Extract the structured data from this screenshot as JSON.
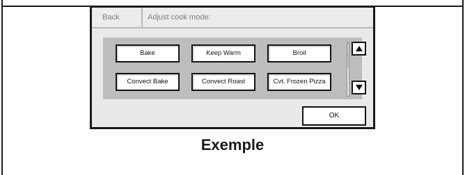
{
  "screen": {
    "back_label": "Back",
    "title": "Adjust cook mode:",
    "modes": [
      "Bake",
      "Keep Warm",
      "Broil",
      "Convect Bake",
      "Convect Roast",
      "Cvt. Frozen Pizza"
    ],
    "scroll_up_icon": "triangle-up-icon",
    "scroll_down_icon": "triangle-down-icon",
    "ok_label": "OK"
  },
  "caption": "Exemple",
  "colors": {
    "screen_bg": "#e9e9e9",
    "panel_bg": "#bdbdbd",
    "border": "#1a1a1a",
    "muted_text": "#7d7d7d"
  }
}
